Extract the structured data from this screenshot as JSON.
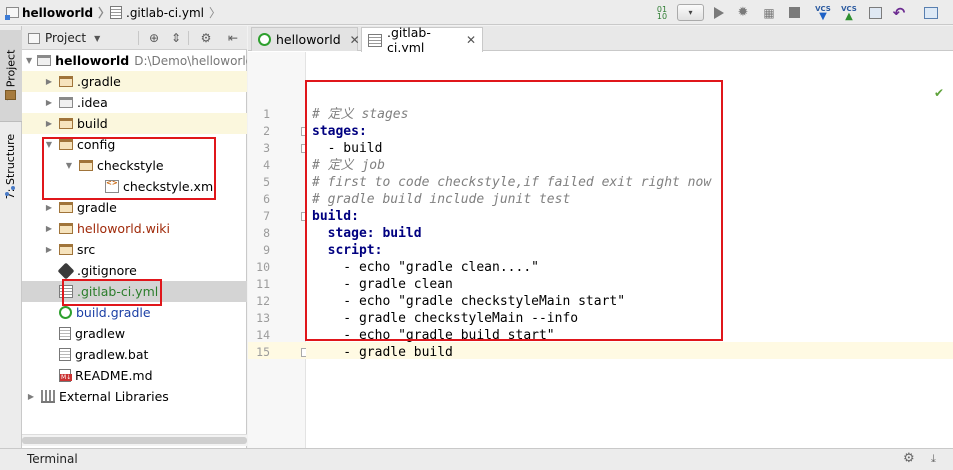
{
  "breadcrumb": {
    "project": "helloworld",
    "file": ".gitlab-ci.yml"
  },
  "toolbar": {
    "build_icon": "make-project-icon",
    "run_config": "▾",
    "vcs_label": "VCS"
  },
  "side_tabs": {
    "project": "1: Project",
    "structure": "7: Structure"
  },
  "project_panel": {
    "selector": "Project",
    "root_name": "helloworld",
    "root_path": "D:\\Demo\\helloworld",
    "items": [
      {
        "label": ".gradle"
      },
      {
        "label": ".idea"
      },
      {
        "label": "build"
      },
      {
        "label": "config"
      },
      {
        "label": "checkstyle"
      },
      {
        "label": "checkstyle.xml"
      },
      {
        "label": "gradle"
      },
      {
        "label": "helloworld.wiki"
      },
      {
        "label": "src"
      },
      {
        "label": ".gitignore"
      },
      {
        "label": ".gitlab-ci.yml"
      },
      {
        "label": "build.gradle"
      },
      {
        "label": "gradlew"
      },
      {
        "label": "gradlew.bat"
      },
      {
        "label": "README.md"
      },
      {
        "label": "External Libraries"
      }
    ]
  },
  "editor": {
    "tabs": [
      {
        "label": "helloworld"
      },
      {
        "label": ".gitlab-ci.yml"
      }
    ],
    "lines": [
      {
        "num": "1",
        "text": "# 定义 stages"
      },
      {
        "num": "2",
        "text": "stages:"
      },
      {
        "num": "3",
        "text": "  - build"
      },
      {
        "num": "4",
        "text": "# 定义 job"
      },
      {
        "num": "5",
        "text": "# first to code checkstyle,if failed exit right now"
      },
      {
        "num": "6",
        "text": "# gradle build include junit test"
      },
      {
        "num": "7",
        "text": "build:"
      },
      {
        "num": "8",
        "text": "  stage: build"
      },
      {
        "num": "9",
        "text": "  script:"
      },
      {
        "num": "10",
        "text": "    - echo \"gradle clean....\""
      },
      {
        "num": "11",
        "text": "    - gradle clean"
      },
      {
        "num": "12",
        "text": "    - echo \"gradle checkstyleMain start\""
      },
      {
        "num": "13",
        "text": "    - gradle checkstyleMain --info"
      },
      {
        "num": "14",
        "text": "    - echo \"gradle build start\""
      },
      {
        "num": "15",
        "text": "    - gradle build"
      }
    ]
  },
  "bottom": {
    "terminal": "Terminal"
  },
  "colors": {
    "highlight_box": "#e0161b",
    "comment": "#808080",
    "yaml_key": "#000080"
  }
}
